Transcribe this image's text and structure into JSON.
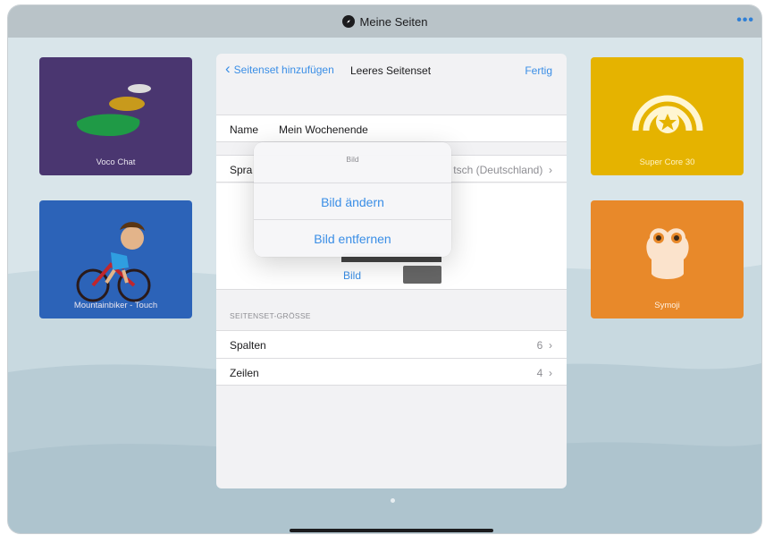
{
  "topbar": {
    "title": "Meine Seiten",
    "title_icon": "compass-icon",
    "more_icon": "more-dots-icon",
    "more_label": "•••"
  },
  "tiles": {
    "voco": {
      "label": "Voco Chat",
      "color": "#4a3670"
    },
    "mountain": {
      "label": "Mountainbiker - Touch",
      "color": "#2c63b8"
    },
    "supercore": {
      "label": "Super Core 30",
      "color": "#e5b300"
    },
    "symoji": {
      "label": "Symoji",
      "color": "#e8892a"
    }
  },
  "modal": {
    "back_label": "Seitenset hinzufügen",
    "title": "Leeres Seitenset",
    "done_label": "Fertig",
    "name_label": "Name",
    "name_value": "Mein Wochenende",
    "language_label": "Spra",
    "language_value": "tsch (Deutschland)",
    "bild_label": "Bild",
    "section_header": "SEITENSET-GRÖSSE",
    "columns_label": "Spalten",
    "columns_value": "6",
    "rows_label": "Zeilen",
    "rows_value": "4"
  },
  "popover": {
    "title": "Bild",
    "change_label": "Bild ändern",
    "remove_label": "Bild entfernen"
  },
  "colors": {
    "accent": "#3a8ee6",
    "topbar": "#b9c3c8"
  }
}
